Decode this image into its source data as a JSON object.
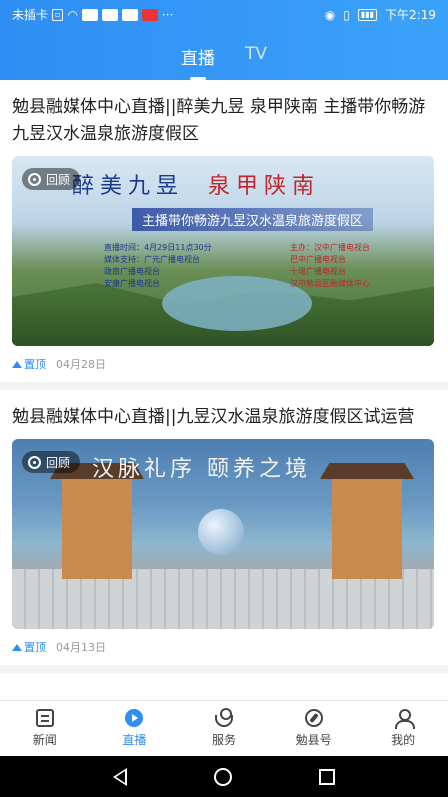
{
  "status_bar": {
    "carrier": "未插卡",
    "time": "下午2:19",
    "battery_icon": "battery-icon",
    "wifi_icon": "wifi-icon"
  },
  "header": {
    "tabs": [
      {
        "label": "直播",
        "active": true
      },
      {
        "label": "TV",
        "active": false
      }
    ],
    "accent": "#2f8ef3"
  },
  "feed": {
    "items": [
      {
        "title": "勉县融媒体中心直播||醉美九昱 泉甲陕南 主播带你畅游九昱汉水温泉旅游度假区",
        "badge": "回顾",
        "pin_label": "置顶",
        "date": "04月28日",
        "banner": {
          "headline_left": "醉美九昱",
          "headline_right": "泉甲陕南",
          "subtitle": "主播带你畅游九昱汉水温泉旅游度假区",
          "info_left": [
            "直播时间：4月29日11点30分",
            "媒体支持：广元广播电视台",
            "陇南广播电视台",
            "安康广播电视台"
          ],
          "info_right": [
            "主办：汉中广播电视台",
            "巴中广播电视台",
            "十堰广播电视台",
            "汉中勉县区融媒体中心"
          ]
        }
      },
      {
        "title": "勉县融媒体中心直播||九昱汉水温泉旅游度假区试运营",
        "badge": "回顾",
        "pin_label": "置顶",
        "date": "04月13日",
        "banner": {
          "headline": "汉脉礼序 颐养之境"
        }
      }
    ]
  },
  "bottom_nav": {
    "items": [
      {
        "label": "新闻",
        "icon": "news-icon",
        "active": false
      },
      {
        "label": "直播",
        "icon": "live-icon",
        "active": true
      },
      {
        "label": "服务",
        "icon": "service-icon",
        "active": false
      },
      {
        "label": "勉县号",
        "icon": "compass-icon",
        "active": false
      },
      {
        "label": "我的",
        "icon": "user-icon",
        "active": false
      }
    ]
  }
}
